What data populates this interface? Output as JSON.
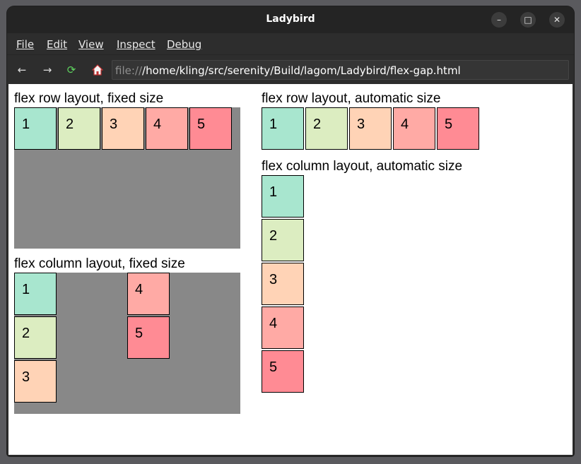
{
  "window": {
    "title": "Ladybird",
    "controls": [
      "minimize-icon",
      "maximize-icon",
      "close-icon"
    ]
  },
  "menu": [
    "File",
    "Edit",
    "View",
    "Inspect",
    "Debug"
  ],
  "toolbar": {
    "icons": [
      "back-arrow-icon",
      "forward-arrow-icon",
      "reload-icon",
      "home-icon"
    ],
    "url_scheme": "file://",
    "url_path": "/home/kling/src/serenity/Build/lagom/Ladybird/flex-gap.html"
  },
  "page": {
    "section_row_fixed": {
      "label": "flex row layout, fixed size",
      "items": [
        "1",
        "2",
        "3",
        "4",
        "5"
      ]
    },
    "section_col_fixed": {
      "label": "flex column layout, fixed size",
      "items": [
        "1",
        "2",
        "3",
        "4",
        "5"
      ]
    },
    "section_row_auto": {
      "label": "flex row layout, automatic size",
      "items": [
        "1",
        "2",
        "3",
        "4",
        "5"
      ]
    },
    "section_col_auto": {
      "label": "flex column layout, automatic size",
      "items": [
        "1",
        "2",
        "3",
        "4",
        "5"
      ]
    },
    "item_colors": [
      "#a8e6cf",
      "#dcedc1",
      "#ffd3b6",
      "#ffaaa5",
      "#ff8b94"
    ],
    "container_color": "#888888"
  }
}
